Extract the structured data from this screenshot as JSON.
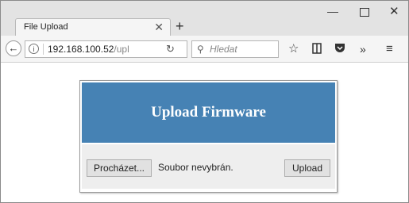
{
  "browser": {
    "tab_title": "File Upload",
    "tab_close": "✕",
    "new_tab": "+",
    "window_controls": {
      "minimize": "—",
      "maximize": "",
      "close": "✕"
    },
    "url_host": "192.168.100.52",
    "url_path": "/upl",
    "search_placeholder": "Hledat",
    "icons": [
      "back-arrow-icon",
      "info-icon",
      "reload-icon",
      "search-icon",
      "star-icon",
      "library-icon",
      "pocket-icon",
      "overflow-icon",
      "hamburger-menu-icon"
    ]
  },
  "page": {
    "title": "Upload Firmware",
    "browse_label": "Procházet...",
    "file_status": "Soubor nevybrán.",
    "upload_label": "Upload",
    "header_color": "#4682b4"
  }
}
